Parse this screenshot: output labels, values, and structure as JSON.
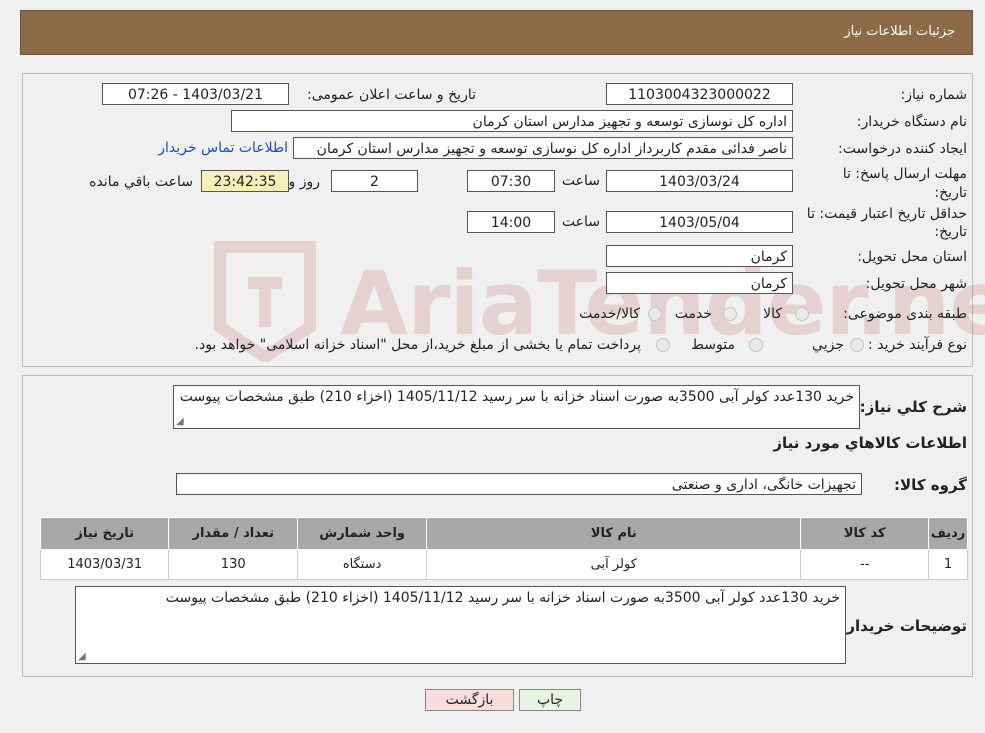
{
  "header": {
    "title": "جزئیات اطلاعات نیاز"
  },
  "form": {
    "need_number_label": "شماره نیاز:",
    "need_number": "1103004323000022",
    "announce_label": "تاریخ و ساعت اعلان عمومی:",
    "announce_value": "1403/03/21 - 07:26",
    "buyer_org_label": "نام دستگاه خریدار:",
    "buyer_org": "اداره کل نوسازی  توسعه و تجهیز مدارس استان کرمان",
    "creator_label": "ایجاد کننده درخواست:",
    "creator": "ناصر فدائی مقدم کاربرداز اداره کل نوسازی  توسعه و تجهیز مدارس استان کرمان",
    "contact_link": "اطلاعات تماس خریدار",
    "deadline_label": "مهلت ارسال پاسخ: تا",
    "deadline_label2": "تاریخ:",
    "deadline_date": "1403/03/24",
    "time_word": "ساعت",
    "deadline_time": "07:30",
    "days": "2",
    "day_and": "روز و",
    "remaining_time": "23:42:35",
    "remaining_label": "ساعت باقي مانده",
    "validity_label": "حداقل تاریخ اعتبار قیمت: تا",
    "validity_label2": "تاریخ:",
    "validity_date": "1403/05/04",
    "validity_time": "14:00",
    "province_label": "استان محل تحویل:",
    "province": "کرمان",
    "city_label": "شهر محل تحویل:",
    "city": "کرمان",
    "category_label": "طبقه بندی موضوعی:",
    "category_options": [
      "کالا",
      "خدمت",
      "کالا/خدمت"
    ],
    "process_label": "نوع فرآیند خرید :",
    "process_options": [
      "جزيي",
      "متوسط"
    ],
    "process_note": "پرداخت تمام یا بخشی از مبلغ خرید،از محل \"اسناد خزانه اسلامی\" خواهد بود."
  },
  "summary": {
    "desc_label": "شرح کلي نیاز:",
    "desc": "خرید 130عدد کولر آبی 3500به صورت اسناد خزانه با سر رسید 1405/11/12 (اخزاء 210) طبق مشخصات پیوست",
    "items_heading": "اطلاعات کالاهاي مورد نیاز",
    "group_label": "گروه کالا:",
    "group": "تجهیزات خانگی، اداری و صنعتی",
    "table": {
      "headers": [
        "ردیف",
        "کد کالا",
        "نام کالا",
        "واحد شمارش",
        "تعداد / مقدار",
        "تاریخ نیاز"
      ],
      "rows": [
        [
          "1",
          "--",
          "کولر آبی",
          "دستگاه",
          "130",
          "1403/03/31"
        ]
      ]
    },
    "buyer_notes_label": "توضیحات خریدار:",
    "buyer_notes": "خرید 130عدد کولر آبی 3500به صورت اسناد خزانه با سر رسید 1405/11/12 (اخزاء 210) طبق مشخصات پیوست"
  },
  "buttons": {
    "print": "چاپ",
    "back": "بازگشت"
  },
  "watermark": {
    "text": "AriaTender.neT"
  },
  "colors": {
    "header_bg": "#8b6a47",
    "link": "#1a4fc4",
    "back_btn": "#f9dcdc",
    "print_btn": "#e8f4e4"
  }
}
